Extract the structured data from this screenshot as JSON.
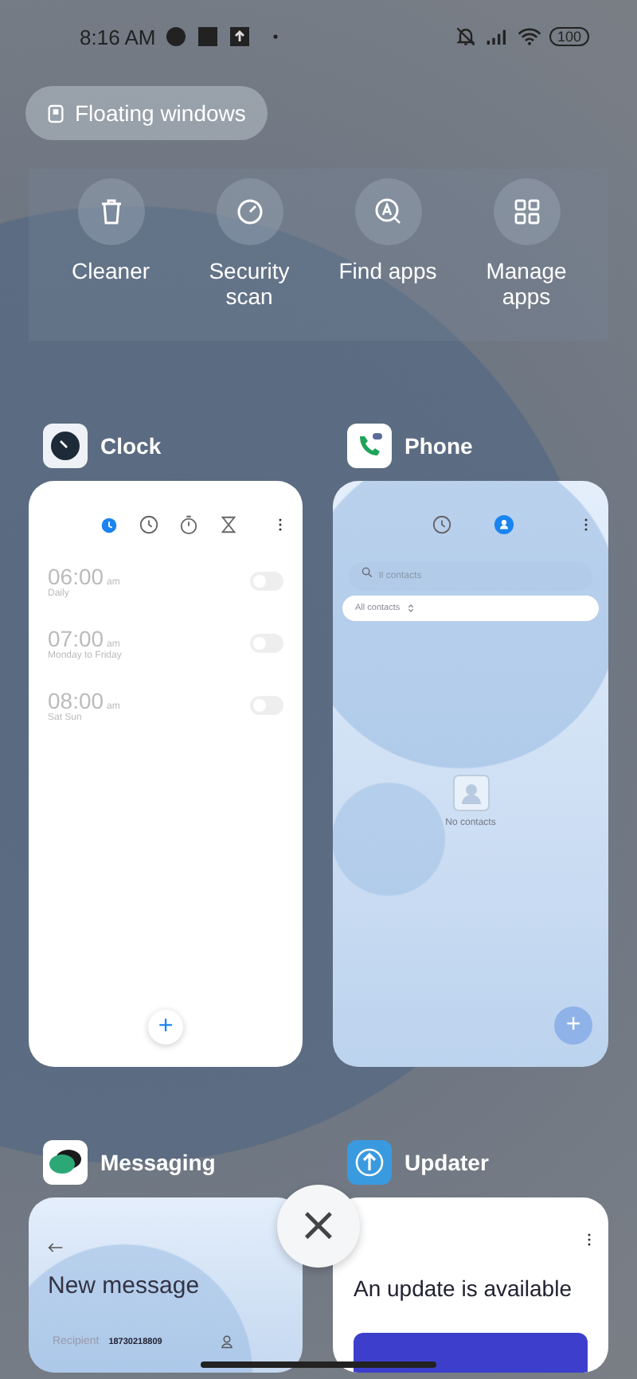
{
  "status_bar": {
    "time": "8:16 AM",
    "battery": "100"
  },
  "floating_windows": {
    "label": "Floating windows"
  },
  "shortcuts": [
    {
      "kind": "trash",
      "label": "Cleaner"
    },
    {
      "kind": "gauge",
      "label": "Security scan"
    },
    {
      "kind": "find",
      "label": "Find apps"
    },
    {
      "kind": "grid",
      "label": "Manage apps"
    }
  ],
  "apps": [
    {
      "kind": "clock",
      "name": "Clock",
      "tabs": [
        {
          "kind": "alarm",
          "selected": true
        },
        {
          "kind": "clock",
          "selected": false
        },
        {
          "kind": "stopwatch",
          "selected": false
        },
        {
          "kind": "timer",
          "selected": false
        }
      ],
      "alarms": [
        {
          "time": "06:00",
          "period": "am",
          "repeat": "Daily",
          "on": false
        },
        {
          "time": "07:00",
          "period": "am",
          "repeat": "Monday to Friday",
          "on": false
        },
        {
          "time": "08:00",
          "period": "am",
          "repeat": "Sat Sun",
          "on": false
        }
      ],
      "fab": "+"
    },
    {
      "kind": "phone",
      "name": "Phone",
      "tabs": [
        {
          "kind": "calls",
          "selected": false
        },
        {
          "kind": "contacts",
          "selected": true
        }
      ],
      "search": {
        "placeholder": "ll contacts"
      },
      "filter": "All contacts",
      "empty": "No contacts",
      "fab": "+"
    },
    {
      "kind": "messaging",
      "name": "Messaging",
      "title": "New message",
      "recipient_label": "Recipient",
      "recipient": "18730218809"
    },
    {
      "kind": "updater",
      "name": "Updater",
      "title": "An update is available"
    }
  ],
  "close_button": "×"
}
